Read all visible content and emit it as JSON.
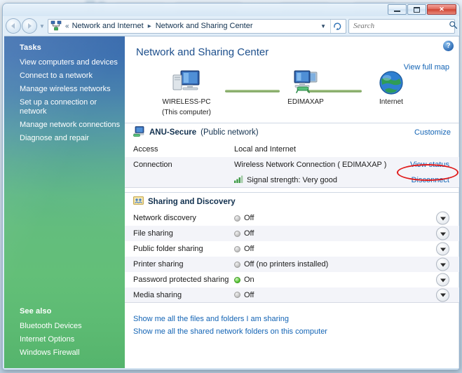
{
  "window": {
    "minimize_label": "Minimize",
    "maximize_label": "Maximize",
    "close_label": "Close"
  },
  "navbar": {
    "back_label": "Back",
    "forward_label": "Forward",
    "recent_pages_label": "Recent Pages",
    "address_icon": "network-icon",
    "overflow_chevron": "«",
    "crumbs": [
      "Network and Internet",
      "Network and Sharing Center"
    ],
    "crumb_separator": "▸",
    "dropdown_caret": "▼",
    "refresh_label": "↺",
    "search": {
      "placeholder": "Search",
      "value": "",
      "icon": "search-icon"
    }
  },
  "sidebar": {
    "tasks_heading": "Tasks",
    "tasks": [
      "View computers and devices",
      "Connect to a network",
      "Manage wireless networks",
      "Set up a connection or network",
      "Manage network connections",
      "Diagnose and repair"
    ],
    "see_also_heading": "See also",
    "see_also": [
      "Bluetooth Devices",
      "Internet Options",
      "Windows Firewall"
    ]
  },
  "content": {
    "help_label": "?",
    "page_title": "Network and Sharing Center",
    "view_full_map": "View full map",
    "map": {
      "nodes": [
        {
          "label": "WIRELESS-PC",
          "sublabel": "(This computer)",
          "icon": "computer-icon"
        },
        {
          "label": "EDIMAXAP",
          "sublabel": "",
          "icon": "access-point-icon"
        },
        {
          "label": "Internet",
          "sublabel": "",
          "icon": "globe-icon"
        }
      ]
    },
    "network_section": {
      "icon": "network-computer-icon",
      "name": "ANU-Secure",
      "type": "(Public network)",
      "customize_link": "Customize",
      "rows": [
        {
          "label": "Access",
          "value": "Local and Internet",
          "action": ""
        },
        {
          "label": "Connection",
          "value": "Wireless Network Connection (  EDIMAXAP  )",
          "action": "View status"
        },
        {
          "label": "",
          "value": "Signal strength:  Very good",
          "value_icon": "signal-bars-icon",
          "action": "Disconnect"
        }
      ]
    },
    "sharing_section": {
      "icon": "sharing-folder-icon",
      "title": "Sharing and Discovery",
      "rows": [
        {
          "label": "Network discovery",
          "state": "off",
          "value": "Off"
        },
        {
          "label": "File sharing",
          "state": "off",
          "value": "Off"
        },
        {
          "label": "Public folder sharing",
          "state": "off",
          "value": "Off"
        },
        {
          "label": "Printer sharing",
          "state": "off",
          "value": "Off (no printers installed)"
        },
        {
          "label": "Password protected sharing",
          "state": "on",
          "value": "On"
        },
        {
          "label": "Media sharing",
          "state": "off",
          "value": "Off"
        }
      ],
      "expand_icon": "chevron-down-icon"
    },
    "bottom_links": [
      "Show me all the files and folders I am sharing",
      "Show me all the shared network folders on this computer"
    ]
  },
  "annotation": {
    "shape": "ellipse",
    "color": "#e01b1b",
    "target": "View status"
  }
}
